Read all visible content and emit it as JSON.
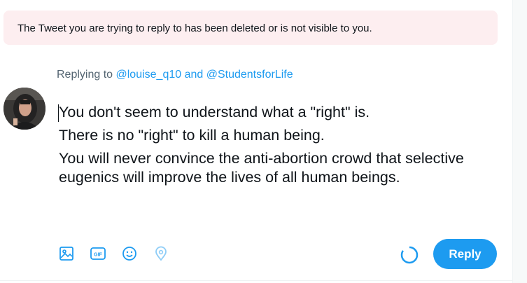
{
  "notice": {
    "text": "The Tweet you are trying to reply to has been deleted or is not visible to you."
  },
  "replying": {
    "prefix": "Replying to ",
    "handles": "@louise_q10 and @StudentsforLife"
  },
  "tweet": {
    "lines": [
      "You don't seem to understand what a \"right\" is.",
      "There is no \"right\" to kill a human being.",
      "You will never convince the anti-abortion crowd that selective eugenics will improve the lives of all human beings."
    ]
  },
  "toolbar": {
    "icons": [
      "image-icon",
      "gif-icon",
      "emoji-icon",
      "location-icon"
    ],
    "gif_label": "GIF"
  },
  "reply_button": {
    "label": "Reply"
  },
  "colors": {
    "accent": "#1d9bf0",
    "notice_bg": "#fdeef0",
    "secondary_text": "#536471"
  }
}
